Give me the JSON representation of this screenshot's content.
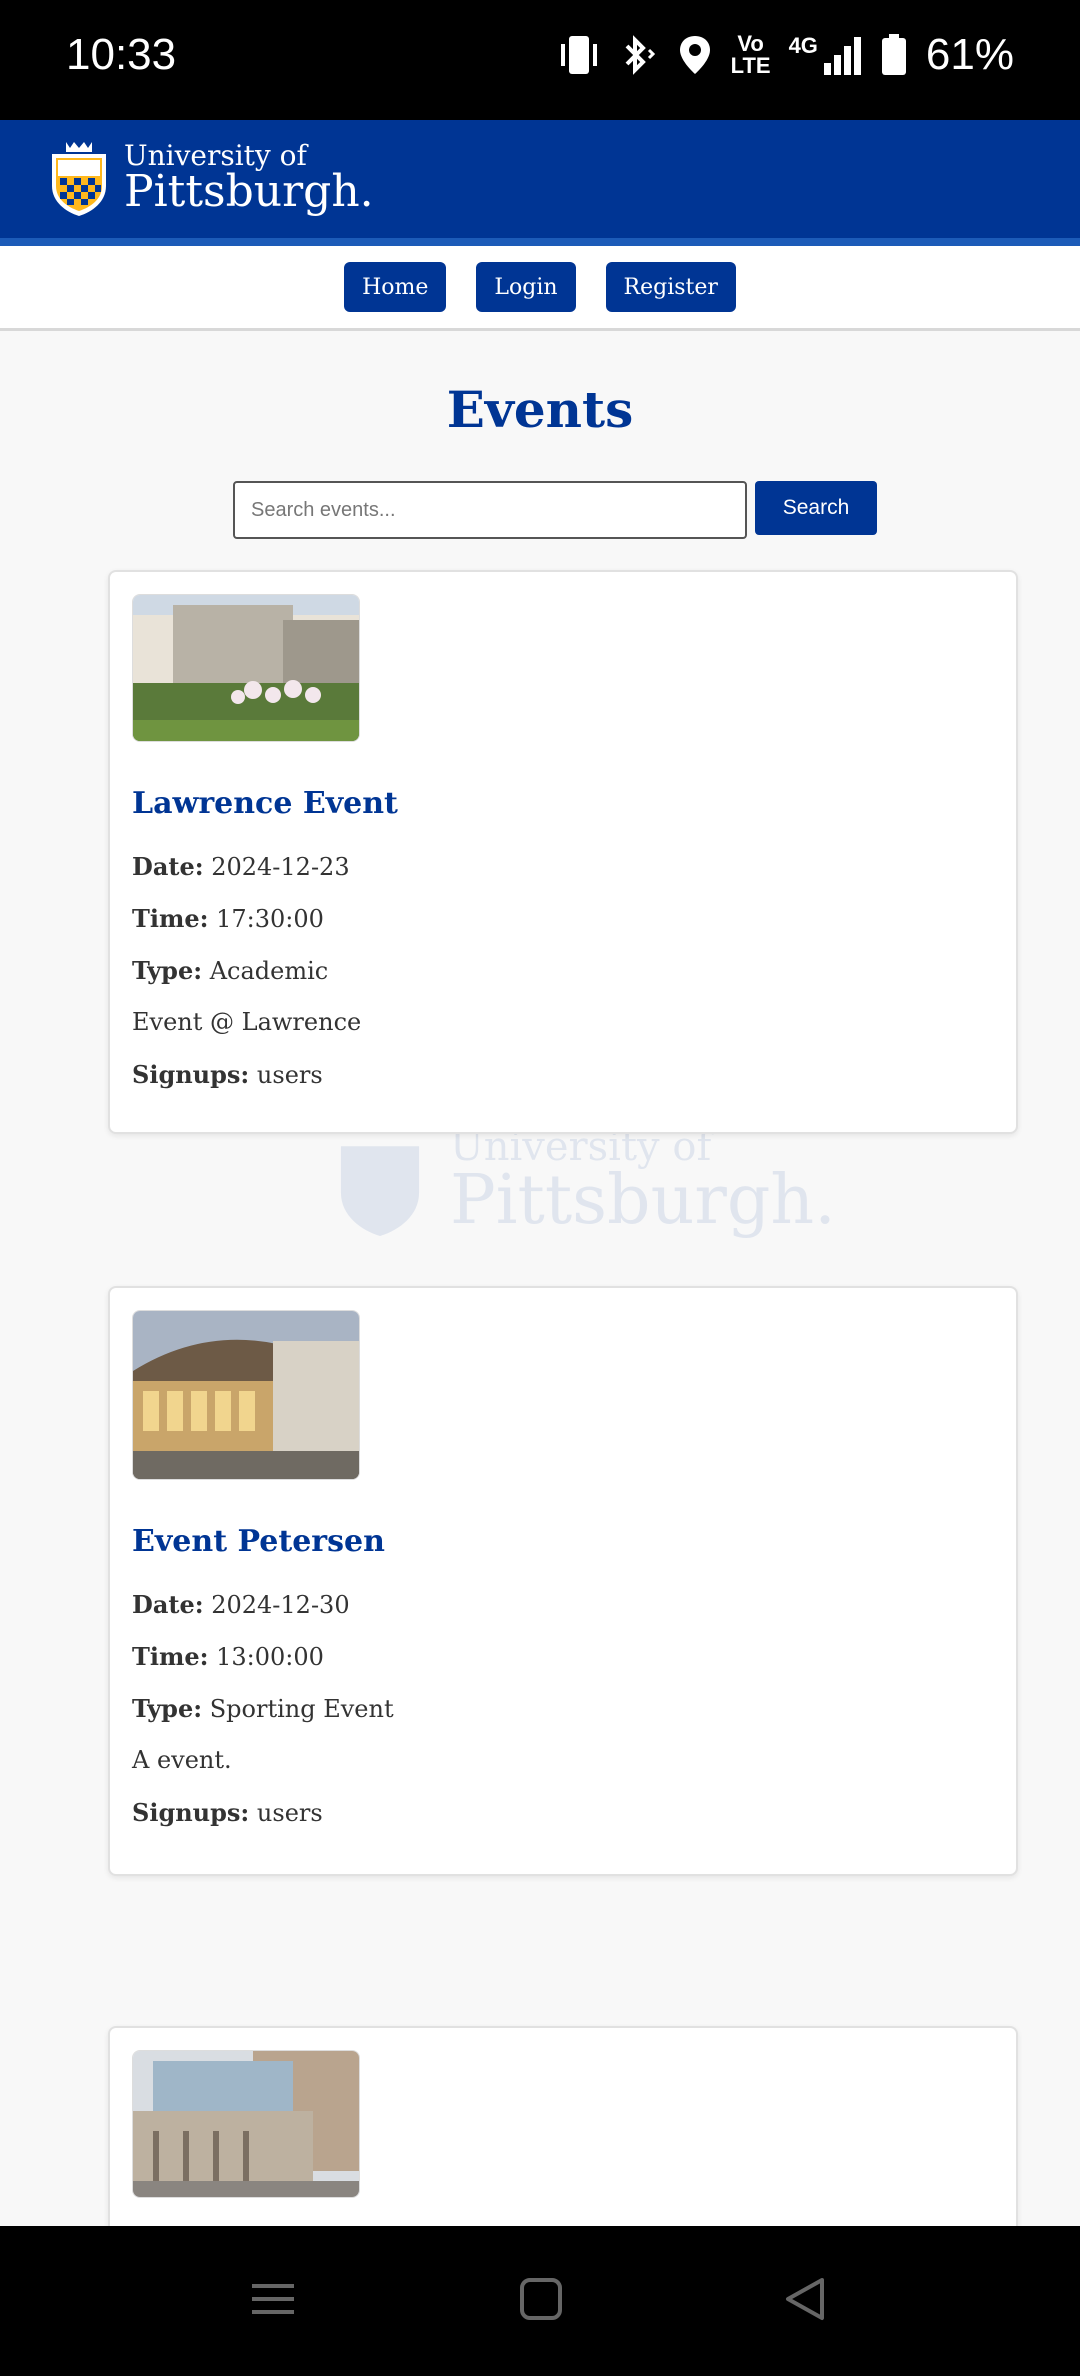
{
  "status_bar": {
    "time": "10:33",
    "battery_percent": "61%",
    "network_label": "4G",
    "volte_label_top": "Vo",
    "volte_label_bottom": "LTE"
  },
  "header": {
    "logo_line1": "University of",
    "logo_line2": "Pittsburgh."
  },
  "nav": {
    "items": [
      {
        "label": "Home"
      },
      {
        "label": "Login"
      },
      {
        "label": "Register"
      }
    ]
  },
  "page": {
    "title": "Events"
  },
  "search": {
    "placeholder": "Search events...",
    "value": "",
    "button_label": "Search"
  },
  "labels": {
    "date": "Date:",
    "time": "Time:",
    "type": "Type:",
    "signups": "Signups:"
  },
  "events": [
    {
      "title": "Lawrence Event",
      "date": "2024-12-23",
      "time": "17:30:00",
      "type": "Academic",
      "description": "Event @ Lawrence",
      "signups": "users"
    },
    {
      "title": "Event Petersen",
      "date": "2024-12-30",
      "time": "13:00:00",
      "type": "Sporting Event",
      "description": "A event.",
      "signups": "users"
    }
  ],
  "colors": {
    "brand": "#003594",
    "brand_accent": "#1c5bb8",
    "gold": "#FFB81C"
  },
  "icons": {
    "status": [
      "vibrate-icon",
      "bluetooth-icon",
      "location-icon",
      "signal-icon",
      "battery-icon"
    ],
    "bottom_nav": [
      "menu-icon",
      "home-square-icon",
      "back-triangle-icon"
    ]
  }
}
